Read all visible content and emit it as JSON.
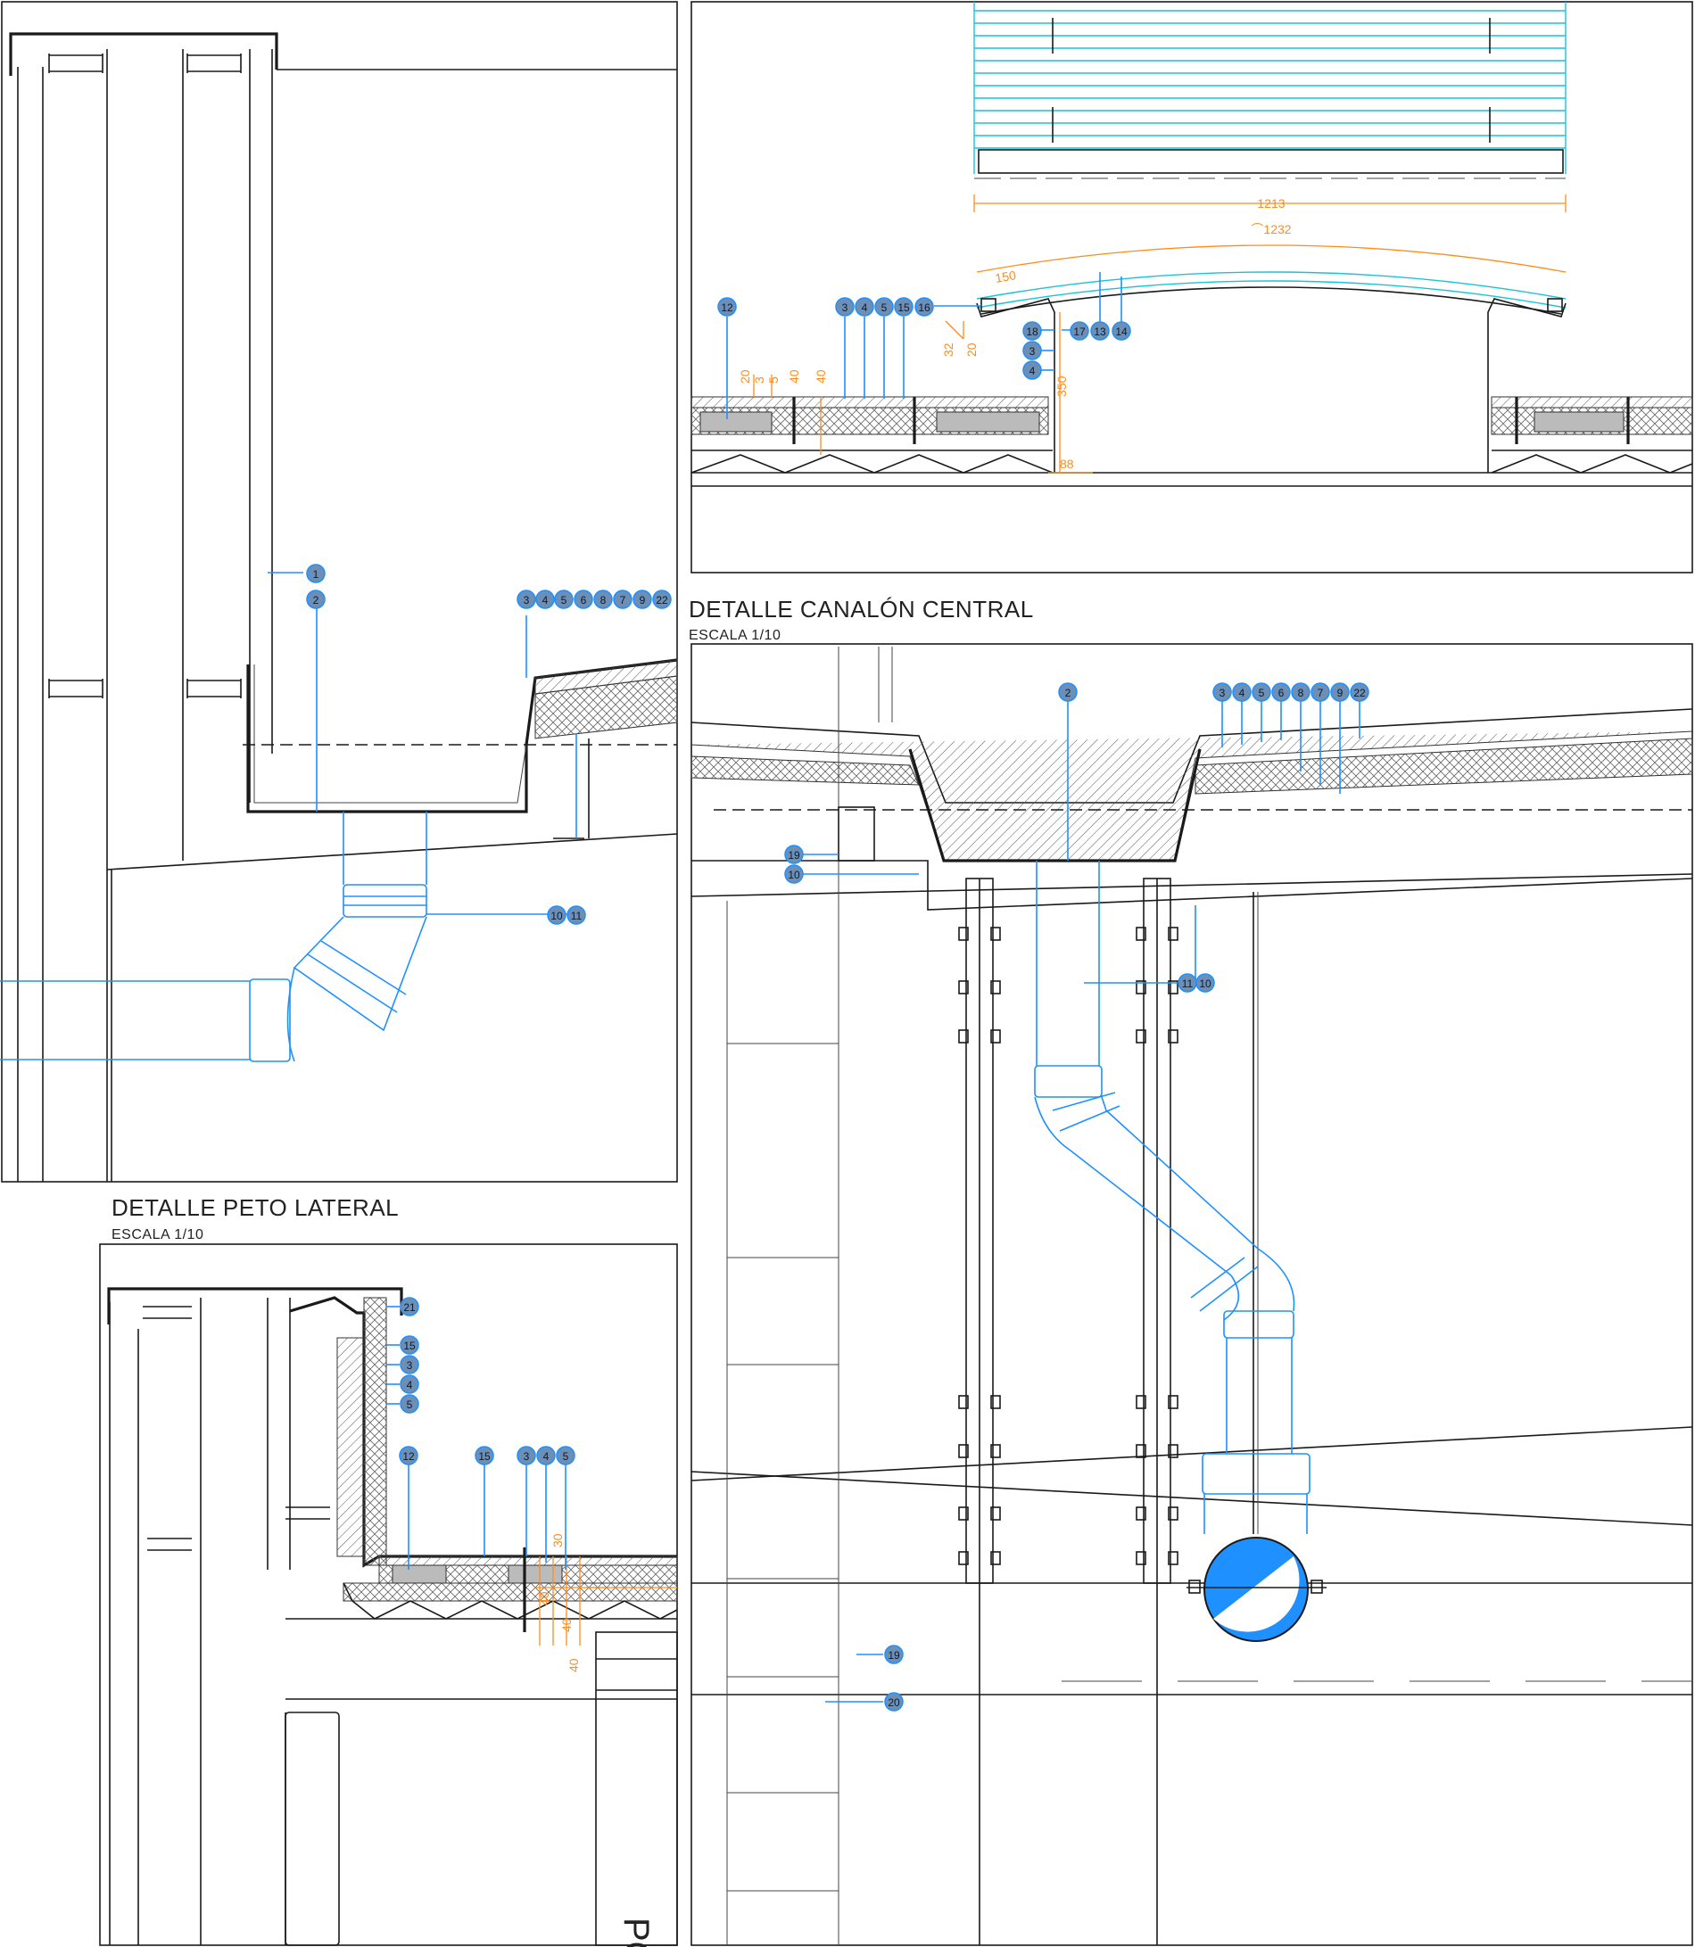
{
  "titles": {
    "central": "DETALLE CANALÓN CENTRAL",
    "central_scale": "ESCALA 1/10",
    "lateral": "DETALLE PETO LATERAL",
    "lateral_scale": "ESCALA 1/10",
    "portico": "PÓRTI"
  },
  "dims": {
    "width_1213": "1213",
    "arc_1232": "⌒1232",
    "d150": "150",
    "d20": "20",
    "d3": "3",
    "d5": "5",
    "d40": "40",
    "d32": "32",
    "d20b": "20",
    "d350": "350",
    "d88": "88",
    "p30": "30",
    "p40a": "40",
    "p40b": "40",
    "p40c": "40"
  },
  "panel_tl_labels": [
    "1",
    "2",
    "3",
    "4",
    "5",
    "6",
    "8",
    "7",
    "9",
    "22",
    "11",
    "10"
  ],
  "panel_tr_labels": [
    "12",
    "3",
    "4",
    "5",
    "15",
    "16",
    "18",
    "17",
    "13",
    "14",
    "3",
    "4"
  ],
  "panel_bl_labels": [
    "21",
    "15",
    "3",
    "4",
    "5",
    "12",
    "15",
    "3",
    "4",
    "5"
  ],
  "panel_br_labels": [
    "2",
    "3",
    "4",
    "5",
    "6",
    "8",
    "7",
    "9",
    "22",
    "19",
    "10",
    "11",
    "10",
    "19",
    "20"
  ],
  "colors": {
    "linework": "#1a1a1a",
    "pipe_blue": "#1e90ff",
    "skylight_cyan": "#19c3d6",
    "dimension_orange": "#ff8c1a",
    "bubble_fill": "#6d8fb6"
  }
}
